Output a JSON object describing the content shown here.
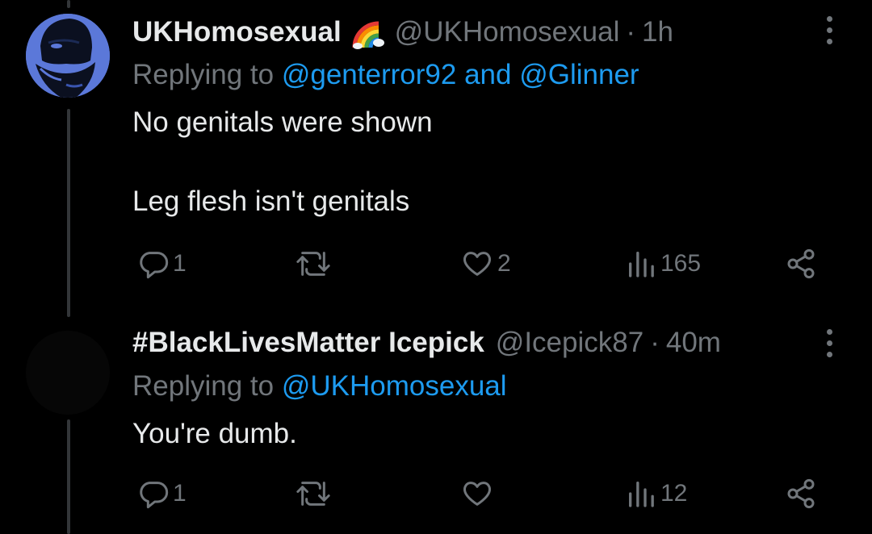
{
  "tweets": [
    {
      "display_name": "UKHomosexual",
      "name_emoji": "rainbow-icon",
      "handle": "@UKHomosexual",
      "separator": "·",
      "time": "1h",
      "replying_prefix": "Replying to",
      "mention_1": "@genterror92",
      "joiner": "and",
      "mention_2": "@Glinner",
      "text_line_1": "No genitals were shown",
      "text_line_2": "Leg flesh isn't genitals",
      "reply_count": "1",
      "retweet_count": "",
      "like_count": "2",
      "view_count": "165"
    },
    {
      "display_name": "#BlackLivesMatter Icepick",
      "handle": "@Icepick87",
      "separator": "·",
      "time": "40m",
      "replying_prefix": "Replying to",
      "mention_1": "@UKHomosexual",
      "text_line_1": "You're dumb.",
      "reply_count": "1",
      "retweet_count": "",
      "like_count": "",
      "view_count": "12"
    }
  ],
  "colors": {
    "background": "#000000",
    "text_primary": "#e7e9ea",
    "text_secondary": "#71767b",
    "link": "#1d9bf0",
    "avatar_1": "#5b78d9",
    "thread_line": "#333639"
  }
}
